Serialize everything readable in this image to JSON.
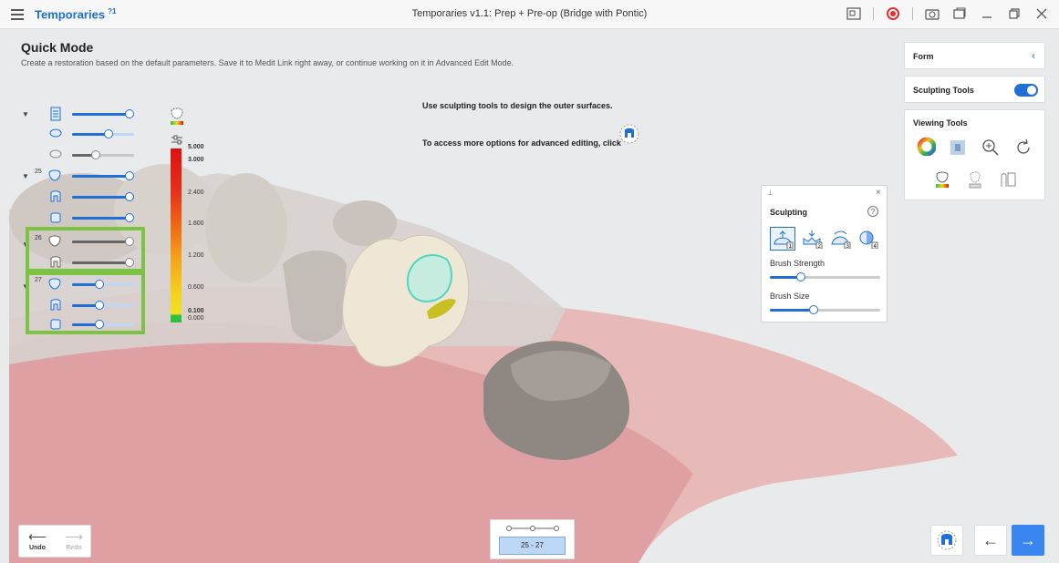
{
  "window": {
    "app_name": "Temporaries",
    "app_badge": "?1",
    "title": "Temporaries v1.1: Prep + Pre-op (Bridge with Pontic)"
  },
  "header": {
    "title": "Quick Mode",
    "description": "Create a restoration based on the default parameters. Save it to Medit Link right away, or continue working on it in Advanced Edit Mode."
  },
  "instructions": {
    "line1": "Use sculpting tools to design the outer surfaces.",
    "line2": "To access more options for advanced editing, click"
  },
  "tree": {
    "tooth_25": "25",
    "tooth_26": "26",
    "tooth_27": "27"
  },
  "scale": {
    "labels": [
      "5.000",
      "3.000",
      "2.400",
      "1.800",
      "1.200",
      "0.600",
      "0.100",
      "0.000"
    ]
  },
  "right_panel": {
    "form_label": "Form",
    "sculpting_tools_label": "Sculpting Tools",
    "sculpting_tools_enabled": true,
    "viewing_tools_label": "Viewing Tools"
  },
  "sculpting_popup": {
    "title": "Sculpting",
    "help": "?",
    "tool_numbers": [
      "1",
      "2",
      "3",
      "4"
    ],
    "brush_strength_label": "Brush Strength",
    "brush_strength_value": 0.28,
    "brush_size_label": "Brush Size",
    "brush_size_value": 0.4
  },
  "bottom": {
    "undo_label": "Undo",
    "redo_label": "Redo",
    "range_label": "25 - 27"
  },
  "colors": {
    "accent": "#1f6fd6",
    "highlight": "#7cc243"
  }
}
